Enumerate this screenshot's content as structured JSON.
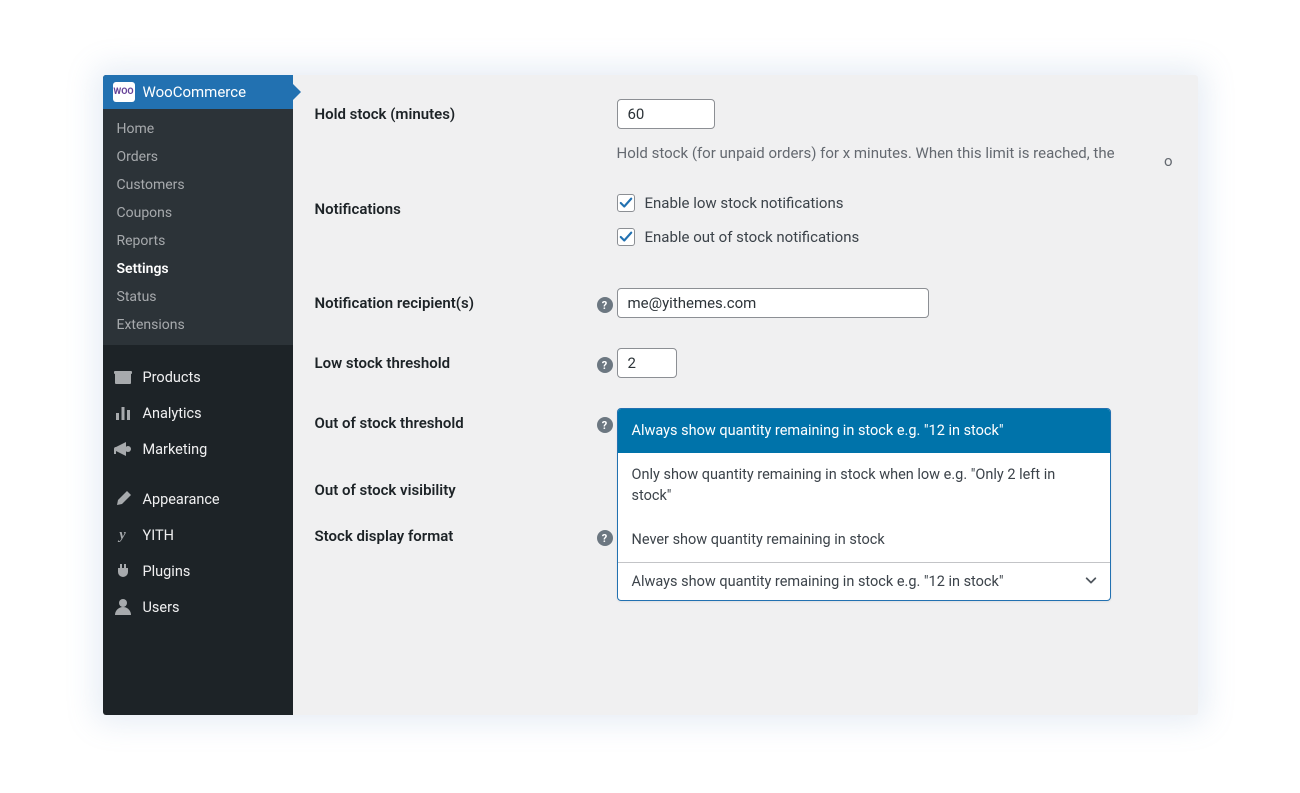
{
  "sidebar": {
    "header": "WooCommerce",
    "woo_badge": "WOO",
    "submenu": [
      {
        "label": "Home"
      },
      {
        "label": "Orders"
      },
      {
        "label": "Customers"
      },
      {
        "label": "Coupons"
      },
      {
        "label": "Reports"
      },
      {
        "label": "Settings",
        "current": true
      },
      {
        "label": "Status"
      },
      {
        "label": "Extensions"
      }
    ],
    "mainmenu": [
      {
        "label": "Products",
        "icon": "archive-icon"
      },
      {
        "label": "Analytics",
        "icon": "chart-bar-icon"
      },
      {
        "label": "Marketing",
        "icon": "megaphone-icon"
      },
      {
        "gap": true
      },
      {
        "label": "Appearance",
        "icon": "brush-icon"
      },
      {
        "label": "YITH",
        "icon": "yith-icon"
      },
      {
        "label": "Plugins",
        "icon": "plug-icon"
      },
      {
        "label": "Users",
        "icon": "user-icon"
      }
    ]
  },
  "form": {
    "hold_stock": {
      "label": "Hold stock (minutes)",
      "value": "60",
      "desc": "Hold stock (for unpaid orders) for x minutes. When this limit is reached, the"
    },
    "notifications": {
      "label": "Notifications",
      "low": "Enable low stock notifications",
      "out": "Enable out of stock notifications"
    },
    "recipients": {
      "label": "Notification recipient(s)",
      "value": "me@yithemes.com"
    },
    "low_threshold": {
      "label": "Low stock threshold",
      "value": "2"
    },
    "out_threshold": {
      "label": "Out of stock threshold"
    },
    "out_visibility": {
      "label": "Out of stock visibility"
    },
    "display_format": {
      "label": "Stock display format",
      "selected": "Always show quantity remaining in stock e.g. \"12 in stock\"",
      "options": [
        "Always show quantity remaining in stock e.g. \"12 in stock\"",
        "Only show quantity remaining in stock when low e.g. \"Only 2 left in stock\"",
        "Never show quantity remaining in stock"
      ]
    }
  },
  "colors": {
    "accent": "#2271b1"
  }
}
